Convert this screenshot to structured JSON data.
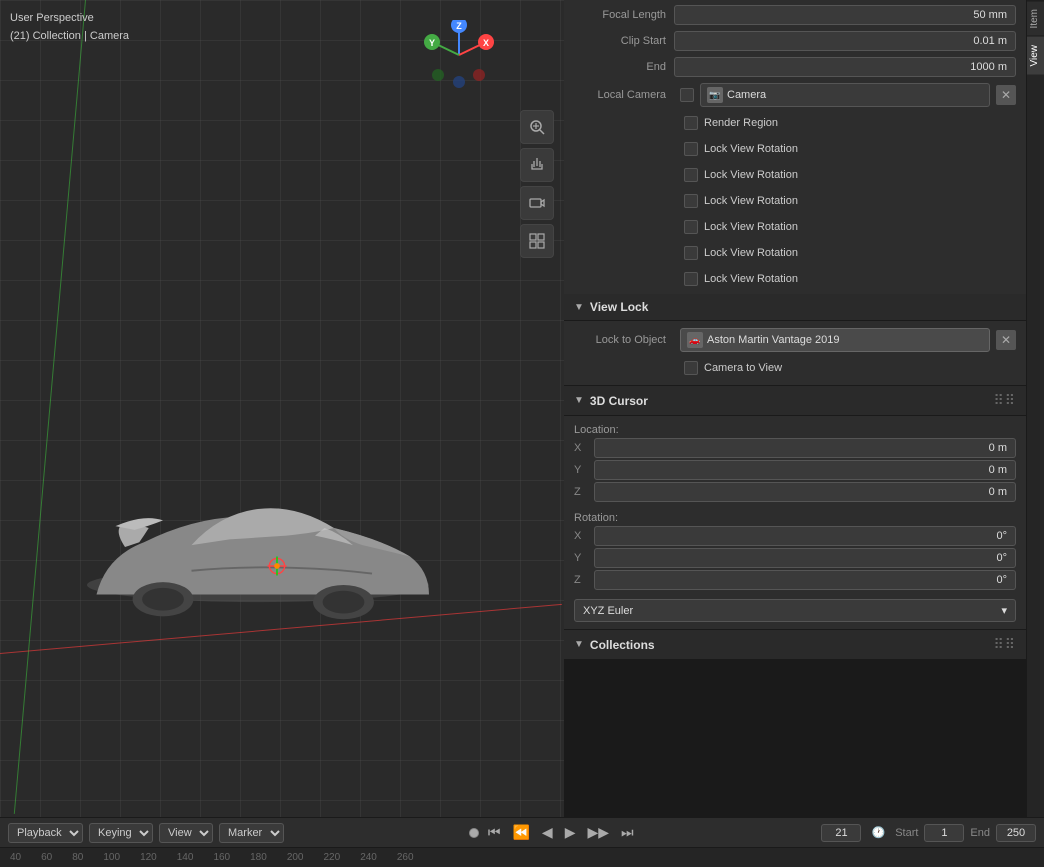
{
  "viewport": {
    "label_line1": "User Perspective",
    "label_line2": "(21) Collection | Camera"
  },
  "toolbar": {
    "icons": [
      {
        "name": "magnify-icon",
        "symbol": "🔍"
      },
      {
        "name": "hand-icon",
        "symbol": "✋"
      },
      {
        "name": "camera-icon",
        "symbol": "🎥"
      },
      {
        "name": "grid-icon",
        "symbol": "⊞"
      }
    ]
  },
  "panel": {
    "tabs": [
      "Item",
      "View"
    ],
    "active_tab": "View",
    "focal_length": {
      "label": "Focal Length",
      "value": "50 mm"
    },
    "clip_start": {
      "label": "Clip Start",
      "value": "0.01 m"
    },
    "clip_end": {
      "label": "End",
      "value": "1000 m"
    },
    "local_camera": {
      "label": "Local Camera",
      "camera_name": "Camera"
    },
    "render_region": {
      "label": "Render Region"
    },
    "lock_view_rotations": [
      "Lock View Rotation",
      "Lock View Rotation",
      "Lock View Rotation",
      "Lock View Rotation",
      "Lock View Rotation",
      "Lock View Rotation"
    ],
    "view_lock_section": "View Lock",
    "lock_to_object": {
      "label": "Lock to Object",
      "value": "Aston Martin Vantage 2019"
    },
    "camera_to_view": {
      "label": "Camera to View"
    },
    "cursor_3d": {
      "section": "3D Cursor",
      "location_label": "Location:",
      "location": {
        "x": "0 m",
        "y": "0 m",
        "z": "0 m"
      },
      "rotation_label": "Rotation:",
      "rotation": {
        "x": "0°",
        "y": "0°",
        "z": "0°"
      },
      "rotation_mode": "XYZ Euler"
    },
    "collections_section": "Collections"
  },
  "timeline": {
    "controls": [
      "Playback",
      "Keying",
      "View",
      "Marker"
    ],
    "current_frame": "21",
    "start_label": "Start",
    "start_value": "1",
    "end_label": "End",
    "end_value": "250",
    "ruler_marks": [
      "40",
      "60",
      "80",
      "100",
      "120",
      "140",
      "160",
      "180",
      "200",
      "220",
      "240",
      "260"
    ]
  }
}
